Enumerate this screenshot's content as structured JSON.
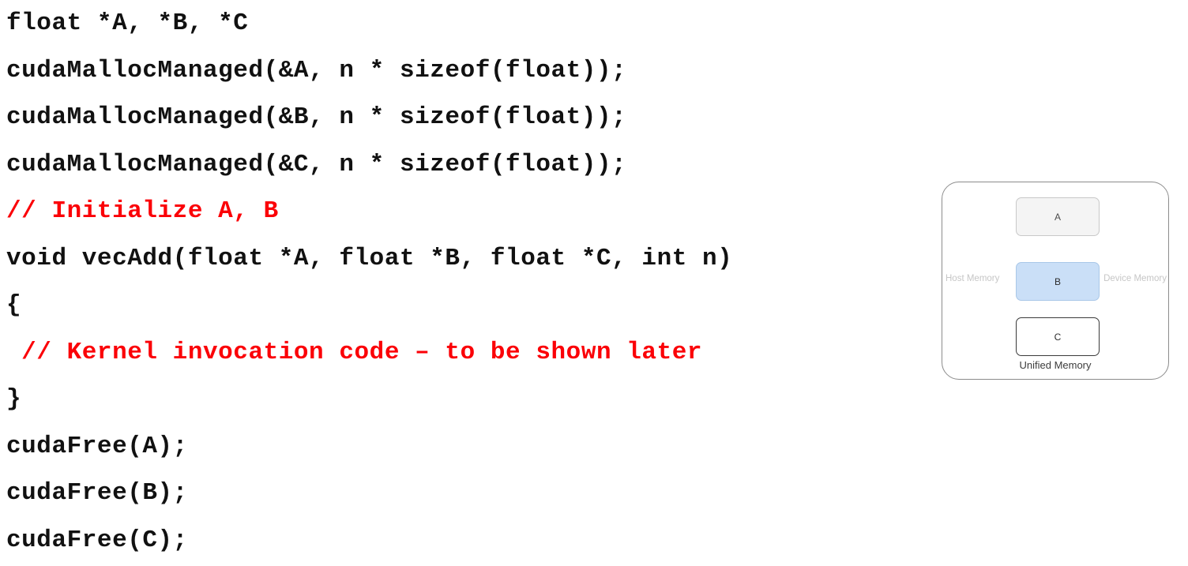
{
  "code": {
    "language": "cuda-c",
    "lines": [
      {
        "text": "float *A, *B, *C",
        "kind": "code"
      },
      {
        "text": "cudaMallocManaged(&A, n * sizeof(float));",
        "kind": "code"
      },
      {
        "text": "cudaMallocManaged(&B, n * sizeof(float));",
        "kind": "code"
      },
      {
        "text": "cudaMallocManaged(&C, n * sizeof(float));",
        "kind": "code"
      },
      {
        "text": "// Initialize A, B",
        "kind": "comment"
      },
      {
        "text": "void vecAdd(float *A, float *B, float *C, int n)",
        "kind": "code"
      },
      {
        "text": "{",
        "kind": "code"
      },
      {
        "text": " // Kernel invocation code – to be shown later",
        "kind": "comment"
      },
      {
        "text": "}",
        "kind": "code"
      },
      {
        "text": "cudaFree(A);",
        "kind": "code"
      },
      {
        "text": "cudaFree(B);",
        "kind": "code"
      },
      {
        "text": "cudaFree(C);",
        "kind": "code"
      }
    ]
  },
  "diagram": {
    "caption": "Unified Memory",
    "left_label": "Host Memory",
    "right_label": "Device Memory",
    "boxes": [
      {
        "label": "A",
        "fill": "#f4f4f4",
        "border": "#c8c8c8"
      },
      {
        "label": "B",
        "fill": "#cadff7",
        "border": "#a9c7e8"
      },
      {
        "label": "C",
        "fill": "#ffffff",
        "border": "#3a3a3a"
      }
    ]
  },
  "colors": {
    "comment_red": "#fb0007",
    "code_black": "#111111",
    "container_border": "#8c8c8c",
    "side_label_gray": "#c6c6c6",
    "caption_gray": "#3c3c3c"
  }
}
